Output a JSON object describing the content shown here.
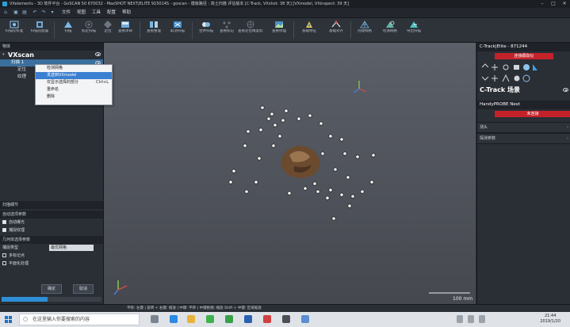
{
  "titlebar": {
    "title": "VXelements - 3D 软件平台 - GoSCAN 50 670032 - MaxSHOT NEXT|ELITE 915014S - goscan - 模板路径 : 高士扫描 评估版本 [C-Track, VXshot: 38 天] [VXmodel, VXinspect: 39 天]"
  },
  "menubar": {
    "items": [
      "文件",
      "视图",
      "工具",
      "配置",
      "帮助"
    ]
  },
  "toolbar": {
    "tools": [
      {
        "label": "扫描仪校准",
        "icon": "calibrate-icon"
      },
      {
        "label": "扫描仪配置",
        "icon": "scanner-config-icon"
      },
      {
        "label": "扫描",
        "icon": "scan-icon"
      },
      {
        "label": "标定扫描",
        "icon": "target-scan-icon"
      },
      {
        "label": "定位",
        "icon": "position-icon"
      },
      {
        "label": "查看项目",
        "icon": "view-project-icon"
      },
      {
        "label": "查看整理",
        "icon": "view-organize-icon"
      },
      {
        "label": "取消扫描",
        "icon": "cancel-scan-icon"
      },
      {
        "label": "合并扫描",
        "icon": "merge-scan-icon"
      },
      {
        "label": "查看标记",
        "icon": "view-markers-icon"
      },
      {
        "label": "查看定位精度标记",
        "icon": "accuracy-markers-icon"
      },
      {
        "label": "查看纹理",
        "icon": "texture-icon"
      },
      {
        "label": "基础特征",
        "icon": "feature-icon"
      },
      {
        "label": "基础对齐",
        "icon": "align-icon"
      },
      {
        "label": "创建网格",
        "icon": "mesh-icon"
      },
      {
        "label": "检测网格",
        "icon": "inspect-mesh-icon"
      },
      {
        "label": "导出扫描",
        "icon": "export-icon"
      }
    ]
  },
  "left_panel": {
    "header": "物体",
    "root": "VXscan",
    "tree": [
      "扫描 1",
      "定位",
      "纹理"
    ],
    "context_menu": [
      {
        "label": "检测网格",
        "shortcut": ""
      },
      {
        "label": "发送到VXmodel",
        "shortcut": ""
      },
      {
        "label": "仅显示选择的部分",
        "shortcut": "Ctrl+L"
      },
      {
        "label": "重命名",
        "shortcut": ""
      },
      {
        "label": "删除",
        "shortcut": ""
      }
    ],
    "sections": {
      "scan_params": "扫描细节",
      "auto_opts": "自动选项参数",
      "check_auto": "自动曝光",
      "check_texture": "捕捉纹理",
      "geometry": "几何体选择参数",
      "mode_label": "捕捉类型",
      "mode_value": "最优网格",
      "check_markers": "多标记点",
      "check_smart": "平面化处理"
    },
    "buttons": {
      "ok": "确定",
      "cancel": "取消"
    },
    "progress": 0.46
  },
  "viewport": {
    "scale_text": "100 mm",
    "accent": "#5a3b25"
  },
  "right_panel": {
    "device_title": "C-Track|Elite - 871244",
    "btn_connect": "连接跟踪仪",
    "scene_title": "C-Track 场景",
    "probe_title": "HandyPROBE Next",
    "btn_probe": "未连接",
    "section_measure": "测头",
    "section_params": "探测参数"
  },
  "statusbar": {
    "hints": "平移: 左键    | 旋转 + 右键: 缩放 | 中键: 平移 | 中键拖拽: 缩放    Shift + 中键: 区域缩放"
  },
  "taskbar": {
    "search_placeholder": "在这里输入你要搜索的内容",
    "time": "21:44",
    "date": "2019/1/20"
  }
}
